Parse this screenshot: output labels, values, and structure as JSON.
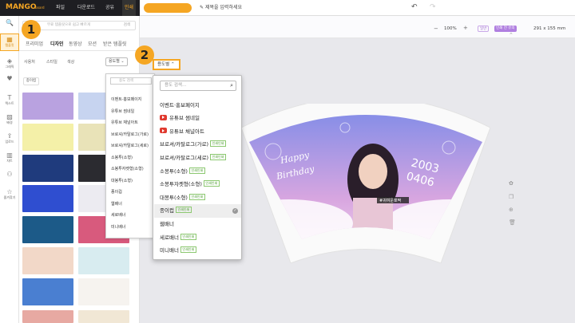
{
  "app": {
    "logo": "MANGO",
    "logo_sub": "board",
    "menus": [
      "파일",
      "다운로드",
      "공유",
      "인쇄"
    ],
    "promo": "",
    "title": "제목을 입력하세요"
  },
  "iconbar": {
    "items": [
      {
        "label": "",
        "glyph": "🔍"
      },
      {
        "label": "템플릿",
        "glyph": "▦"
      },
      {
        "label": "그래픽",
        "glyph": "◈"
      },
      {
        "label": "",
        "glyph": "♥"
      },
      {
        "label": "텍스트",
        "glyph": "T"
      },
      {
        "label": "배경",
        "glyph": "▨"
      },
      {
        "label": "업로드",
        "glyph": "⇪"
      },
      {
        "label": "차트",
        "glyph": "▥"
      },
      {
        "label": "",
        "glyph": "⚇"
      },
      {
        "label": "즐겨찾기",
        "glyph": "☆"
      }
    ]
  },
  "panel": {
    "search_placeholder": "무료 템플릿으로 쉽고 빠르게",
    "search_button": "검색",
    "tabs": [
      "프리미엄",
      "디자인",
      "동영상",
      "모션",
      "받은 템플릿"
    ],
    "filters": [
      "사용처",
      "스타일",
      "색상"
    ],
    "dd_label": "용도별",
    "chip": "종이컵"
  },
  "shadow_dropdown": {
    "search": "용도 검색",
    "items": [
      "이벤트·홍보페이지",
      "유튜브 썸네일",
      "유튜브 채널아트",
      "브로셔/카탈로그(가로)",
      "브로셔/카탈로그(세로)",
      "소봉투(소형)",
      "소봉투자켓형(소형)",
      "대봉투(소형)",
      "종이컵",
      "웹배너",
      "세로배너",
      "미니배너"
    ]
  },
  "canvas": {
    "zoom": "100%",
    "btn1": "일반",
    "btn2": "인쇄 전 유의",
    "size": "291 x 155 mm"
  },
  "dropdown": {
    "header": "용도별",
    "search_placeholder": "용도 검색...",
    "badge": "인쇄인쇄",
    "items": [
      {
        "label": "이벤트·홍보페이지",
        "yt": false,
        "badge": false,
        "selected": false
      },
      {
        "label": "유튜브 썸네일",
        "yt": true,
        "badge": false,
        "selected": false
      },
      {
        "label": "유튜브 채널아트",
        "yt": true,
        "badge": false,
        "selected": false
      },
      {
        "label": "브로셔/카탈로그(가로)",
        "yt": false,
        "badge": true,
        "selected": false
      },
      {
        "label": "브로셔/카탈로그(세로)",
        "yt": false,
        "badge": true,
        "selected": false
      },
      {
        "label": "소봉투(소형)",
        "yt": false,
        "badge": true,
        "selected": false
      },
      {
        "label": "소봉투자켓형(소형)",
        "yt": false,
        "badge": true,
        "selected": false
      },
      {
        "label": "대봉투(소형)",
        "yt": false,
        "badge": true,
        "selected": false
      },
      {
        "label": "종이컵",
        "yt": false,
        "badge": true,
        "selected": true
      },
      {
        "label": "웹배너",
        "yt": false,
        "badge": false,
        "selected": false
      },
      {
        "label": "세로배너",
        "yt": false,
        "badge": true,
        "selected": false
      },
      {
        "label": "미니배너",
        "yt": false,
        "badge": true,
        "selected": false
      }
    ]
  },
  "cup": {
    "text1": "Happy",
    "text2": "Birthday",
    "date1": "2003",
    "date2": "0406",
    "tag": "#귀여운뽀짝"
  },
  "steps": [
    "1",
    "2"
  ],
  "thumbs": [
    {
      "label": "",
      "color": "#b9a2e0"
    },
    {
      "label": "",
      "color": "#c7d4f0"
    },
    {
      "label": "",
      "color": "#f4f0a8"
    },
    {
      "label": "",
      "color": "#e9e3b8"
    },
    {
      "label": "",
      "color": "#1f3b7d"
    },
    {
      "label": "",
      "color": "#2b2b30"
    },
    {
      "label": "",
      "color": "#2f4ed0"
    },
    {
      "label": "",
      "color": "#ecebf1"
    },
    {
      "label": "",
      "color": "#1c5a88"
    },
    {
      "label": "",
      "color": "#d85a7d"
    },
    {
      "label": "",
      "color": "#f2d8c8"
    },
    {
      "label": "",
      "color": "#d8ecf0"
    },
    {
      "label": "",
      "color": "#4a7fd1"
    },
    {
      "label": "",
      "color": "#f6f3ef"
    },
    {
      "label": "",
      "color": "#e7a9a2"
    },
    {
      "label": "",
      "color": "#f1e7d5"
    },
    {
      "label": "",
      "color": "#5a2fb0"
    },
    {
      "label": "",
      "color": "#4ec3b8"
    },
    {
      "label": "",
      "color": "#0c0c12"
    },
    {
      "label": "",
      "color": "#1a1a25"
    },
    {
      "label": "",
      "color": "#c8c8cc"
    },
    {
      "label": "",
      "color": "#c8c8cc"
    }
  ]
}
